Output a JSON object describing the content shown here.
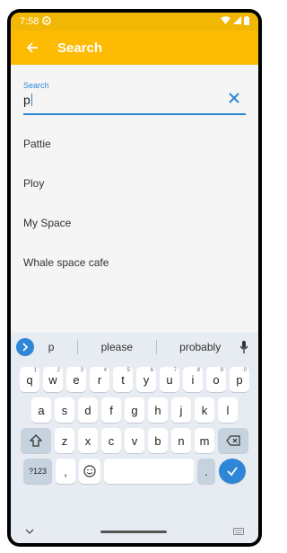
{
  "status_bar": {
    "time": "7:58"
  },
  "app_bar": {
    "title": "Search"
  },
  "search": {
    "label": "Search",
    "value": "p"
  },
  "results": [
    "Pattie",
    "Ploy",
    "My Space",
    "Whale space cafe"
  ],
  "keyboard": {
    "suggestions": [
      "p",
      "please",
      "probably"
    ],
    "row1": [
      {
        "k": "q",
        "h": "1"
      },
      {
        "k": "w",
        "h": "2"
      },
      {
        "k": "e",
        "h": "3"
      },
      {
        "k": "r",
        "h": "4"
      },
      {
        "k": "t",
        "h": "5"
      },
      {
        "k": "y",
        "h": "6"
      },
      {
        "k": "u",
        "h": "7"
      },
      {
        "k": "i",
        "h": "8"
      },
      {
        "k": "o",
        "h": "9"
      },
      {
        "k": "p",
        "h": "0"
      }
    ],
    "row2": [
      "a",
      "s",
      "d",
      "f",
      "g",
      "h",
      "j",
      "k",
      "l"
    ],
    "row3": [
      "z",
      "x",
      "c",
      "v",
      "b",
      "n",
      "m"
    ],
    "symbols_label": "?123",
    "comma": ",",
    "period": "."
  },
  "colors": {
    "accent": "#fdbb04",
    "blue": "#2f86d6"
  }
}
